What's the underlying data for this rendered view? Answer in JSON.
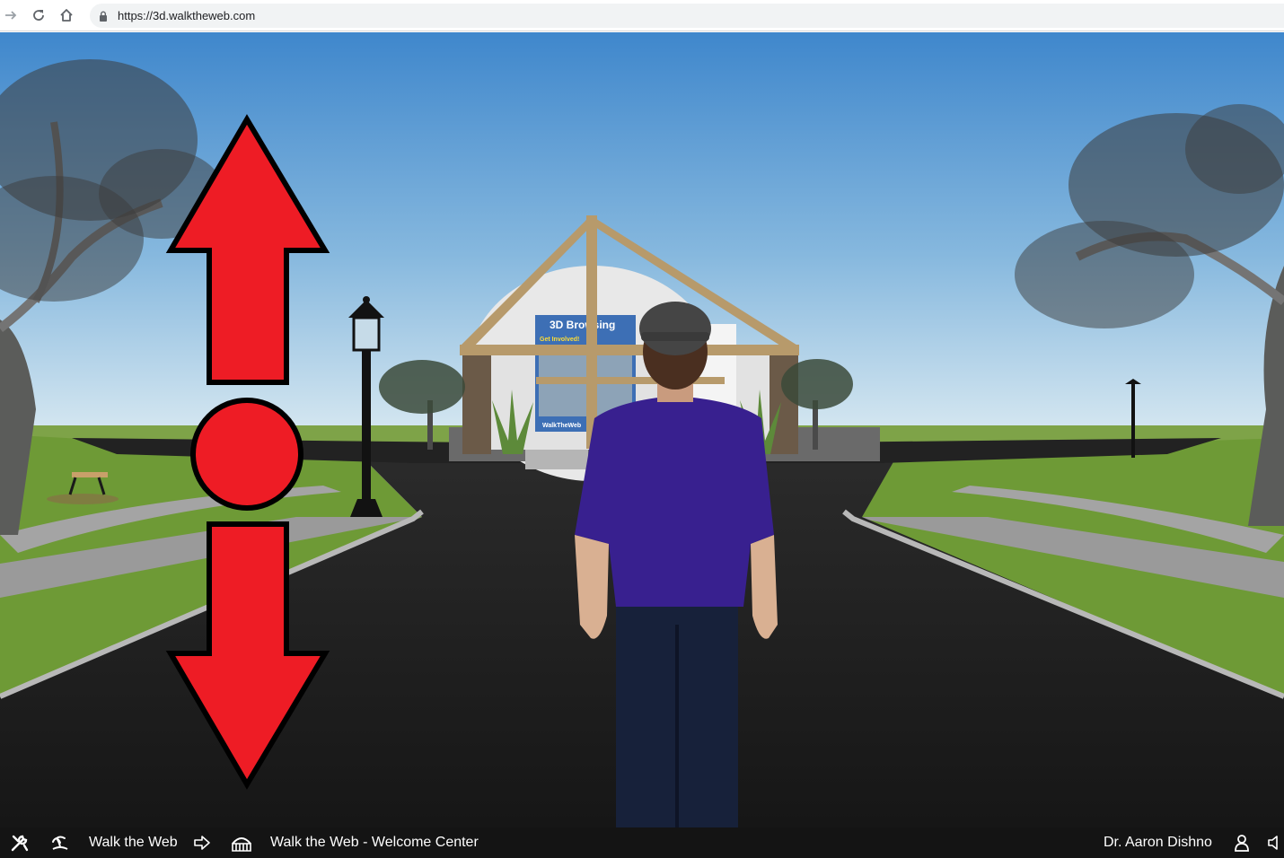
{
  "browser": {
    "url": "https://3d.walktheweb.com",
    "icons": [
      "forward-arrow-icon",
      "reload-icon",
      "home-icon",
      "lock-icon"
    ]
  },
  "scene": {
    "board_title": "3D Browsing",
    "board_subtitle": "Get Involved!",
    "board_footer": "WalkTheWeb",
    "colors": {
      "sky_top": "#4a8fd0",
      "sky_bottom": "#d6e8f2",
      "grass": "#6f9a35",
      "road": "#1e1e1e",
      "arrow": "#ee1c25",
      "shirt": "#3a1e96"
    }
  },
  "bottombar": {
    "site_name": "Walk the Web",
    "location": "Walk the Web - Welcome Center",
    "user_name": "Dr. Aaron Dishno",
    "icons": [
      "tools-icon",
      "island-icon",
      "arrow-right-icon",
      "building-icon",
      "user-icon",
      "speaker-icon"
    ]
  }
}
